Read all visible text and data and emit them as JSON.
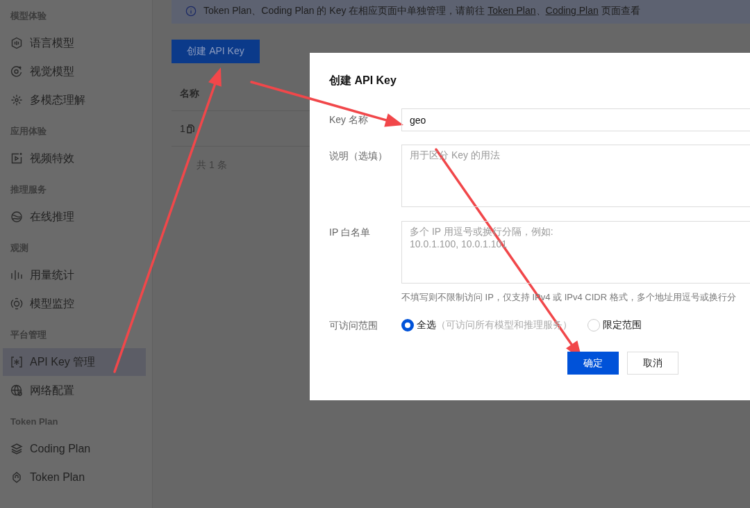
{
  "sidebar": {
    "groups": [
      {
        "title": "模型体验",
        "items": [
          {
            "label": "语言模型",
            "selected": false
          },
          {
            "label": "视觉模型",
            "selected": false
          },
          {
            "label": "多模态理解",
            "selected": false
          }
        ]
      },
      {
        "title": "应用体验",
        "items": [
          {
            "label": "视频特效",
            "selected": false
          }
        ]
      },
      {
        "title": "推理服务",
        "items": [
          {
            "label": "在线推理",
            "selected": false
          }
        ]
      },
      {
        "title": "观测",
        "items": [
          {
            "label": "用量统计",
            "selected": false
          },
          {
            "label": "模型监控",
            "selected": false
          }
        ]
      },
      {
        "title": "平台管理",
        "items": [
          {
            "label": "API Key 管理",
            "selected": true
          },
          {
            "label": "网络配置",
            "selected": false
          }
        ]
      },
      {
        "title": "Token Plan",
        "items": [
          {
            "label": "Coding Plan",
            "selected": false
          },
          {
            "label": "Token Plan",
            "selected": false
          }
        ]
      }
    ]
  },
  "alert": {
    "text_before": "Token Plan、Coding Plan 的 Key 在相应页面中单独管理，请前往",
    "links": [
      "Token Plan",
      "Coding Plan"
    ],
    "separator": "、",
    "text_after": "页面查看"
  },
  "create_button": "创建 API Key",
  "table": {
    "columns": [
      "名称"
    ],
    "rows": [
      [
        "1"
      ]
    ],
    "footer": "共 1 条"
  },
  "dialog": {
    "title": "创建 API Key",
    "fields": [
      {
        "kind": "input",
        "label": "Key 名称",
        "value": "geo"
      },
      {
        "kind": "textarea",
        "label": "说明（选填）",
        "placeholder": "用于区分 Key 的用法"
      },
      {
        "kind": "textarea",
        "label": "IP 白名单",
        "placeholder": "多个 IP 用逗号或换行分隔，例如:\n10.0.1.100, 10.0.1.101",
        "hint": "不填写则不限制访问 IP，仅支持 IPv4 或 IPv4 CIDR 格式，多个地址用逗号或换行分"
      },
      {
        "kind": "radio",
        "label": "可访问范围",
        "options": [
          {
            "label": "全选",
            "note": "（可访问所有模型和推理服务）",
            "selected": true
          },
          {
            "label": "限定范围",
            "selected": false
          }
        ]
      }
    ],
    "buttons": [
      {
        "label": "确定",
        "kind": "primary"
      },
      {
        "label": "取消",
        "kind": "secondary"
      }
    ]
  }
}
